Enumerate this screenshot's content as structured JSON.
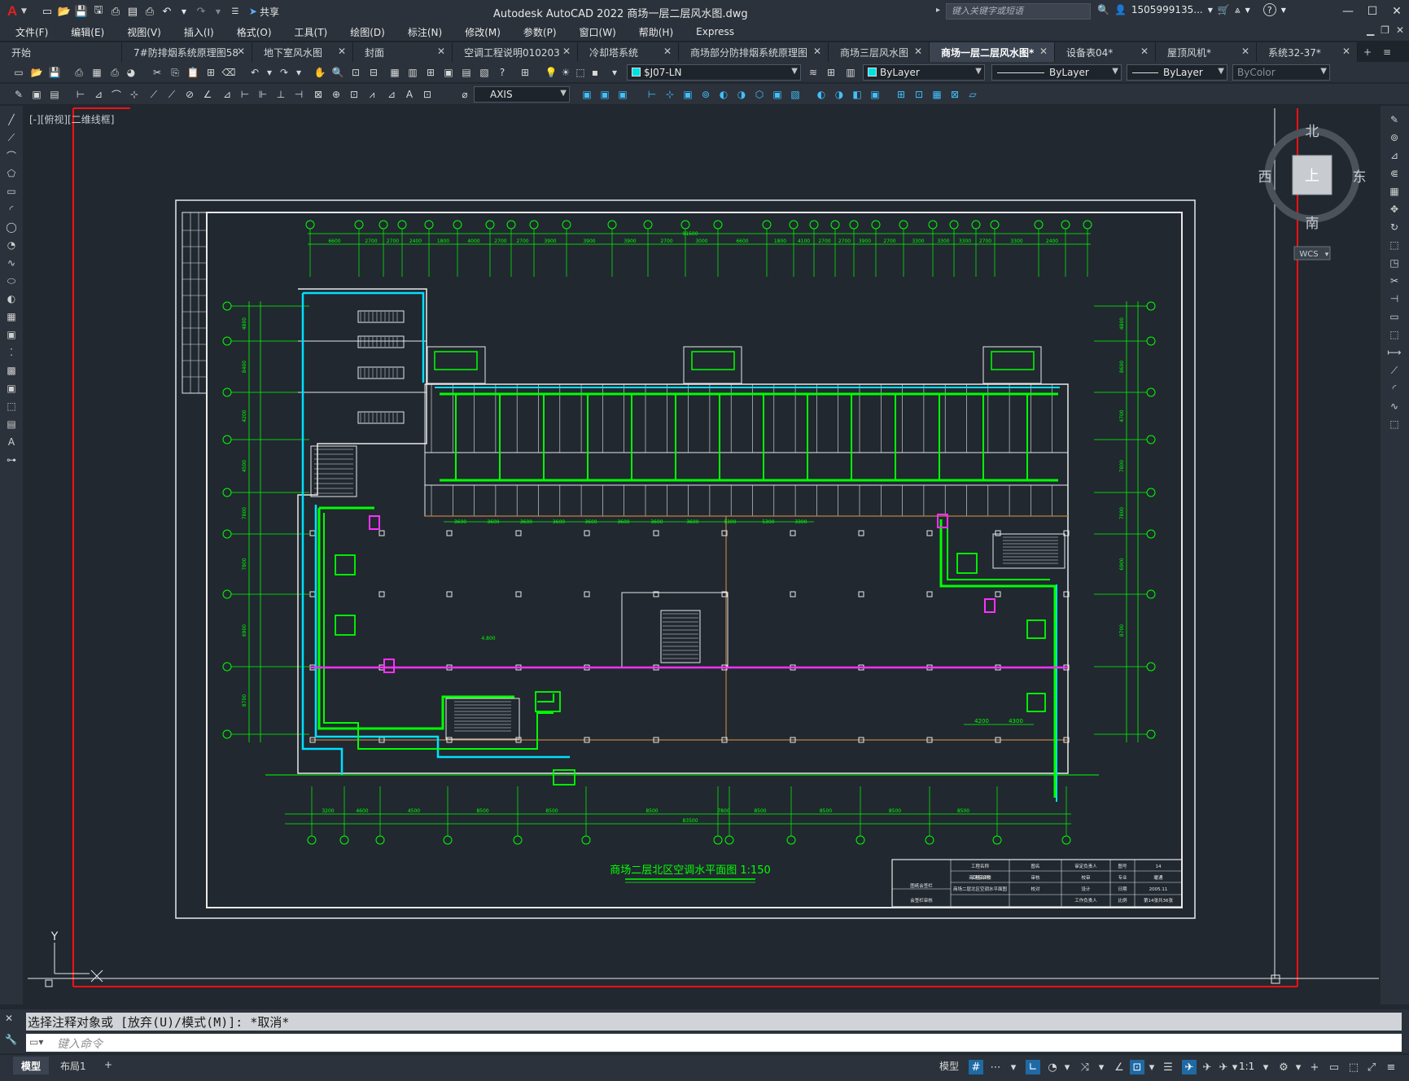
{
  "titlebar": {
    "logo": "A",
    "share_label": "共享",
    "window_title": "Autodesk AutoCAD 2022    商场一层二层风水图.dwg",
    "search_placeholder": "键入关键字或短语",
    "user": "1505999135...",
    "help": "?"
  },
  "menus": [
    "文件(F)",
    "编辑(E)",
    "视图(V)",
    "插入(I)",
    "格式(O)",
    "工具(T)",
    "绘图(D)",
    "标注(N)",
    "修改(M)",
    "参数(P)",
    "窗口(W)",
    "帮助(H)",
    "Express"
  ],
  "tabs": [
    {
      "label": "开始",
      "width": 150,
      "close": false
    },
    {
      "label": "7#防排烟系统原理图58",
      "width": 160,
      "close": true
    },
    {
      "label": "地下室风水图",
      "width": 124,
      "close": true
    },
    {
      "label": "封面",
      "width": 122,
      "close": true
    },
    {
      "label": "空调工程说明010203",
      "width": 154,
      "close": true
    },
    {
      "label": "冷却塔系统",
      "width": 124,
      "close": true
    },
    {
      "label": "商场部分防排烟系统原理图",
      "width": 184,
      "close": true
    },
    {
      "label": "商场三层风水图",
      "width": 124,
      "close": true
    },
    {
      "label": "商场一层二层风水图*",
      "width": 154,
      "close": true,
      "active": true
    },
    {
      "label": "设备表04*",
      "width": 124,
      "close": true
    },
    {
      "label": "屋顶风机*",
      "width": 124,
      "close": true
    },
    {
      "label": "系统32-37*",
      "width": 124,
      "close": true
    }
  ],
  "toolbar": {
    "layer": "$J07-LN",
    "color": "ByLayer",
    "linetype": "ByLayer",
    "lineweight": "ByLayer",
    "plotstyle": "ByColor",
    "dimstyle": "AXIS",
    "layer_color": "#00e0e0"
  },
  "viewport": {
    "label": "[-][俯视][二维线框]"
  },
  "viewcube": {
    "north": "北",
    "south": "南",
    "east": "东",
    "west": "西",
    "face": "上",
    "wcs": "WCS"
  },
  "ucs": {
    "y": "Y"
  },
  "drawing": {
    "title": "商场二层北区空调水平面图  1:150",
    "top_dims": [
      "6600",
      "2700",
      "2700",
      "2400",
      "1800",
      "4000",
      "2700",
      "2700",
      "3900",
      "3900",
      "3900",
      "2700",
      "3000",
      "6600",
      "1800",
      "4100",
      "2700",
      "2700",
      "3900",
      "2700",
      "3300",
      "3300",
      "3300",
      "2700",
      "3300",
      "2400"
    ],
    "top_total": "91500",
    "bottom_dims": [
      "3200",
      "4600",
      "4500",
      "8500",
      "8500",
      "8500",
      "7800",
      "8500",
      "8500",
      "8500",
      "8500"
    ],
    "bottom_total": "83500",
    "mid_dims": [
      "3600",
      "3600",
      "3600",
      "3600",
      "3600",
      "3600",
      "3600",
      "3600",
      "5300",
      "5300",
      "3300"
    ],
    "left_dims": [
      "4800",
      "8400",
      "4200",
      "4500",
      "7800",
      "7800",
      "6900",
      "8700"
    ],
    "right_dims": [
      "4800",
      "8600",
      "4700",
      "7800",
      "7800",
      "6900",
      "8700"
    ],
    "mini_dims": [
      "4200",
      "4300"
    ],
    "level": "4.800"
  },
  "titleblock": {
    "rows": [
      [
        "工程名称",
        "",
        "图名",
        "审定负责人",
        "图号",
        "14"
      ],
      [
        "工程名称",
        "商场综合楼",
        "审核",
        "校审",
        "专业",
        "暖通"
      ],
      [
        "",
        "商场二层北区空调水平面图",
        "校对",
        "设计",
        "日期",
        "2005.11"
      ],
      [
        "",
        "",
        "",
        "工作负责人",
        "比例",
        "第14张共36张"
      ]
    ],
    "left_labels": [
      "图纸会签栏",
      "会签栏审核"
    ]
  },
  "command": {
    "history": "选择注释对象或 [放弃(U)/模式(M)]: *取消*",
    "placeholder": "键入命令"
  },
  "status": {
    "model_tab": "模型",
    "layout_tab": "布局1",
    "model_btn": "模型",
    "scale": "1:1"
  }
}
